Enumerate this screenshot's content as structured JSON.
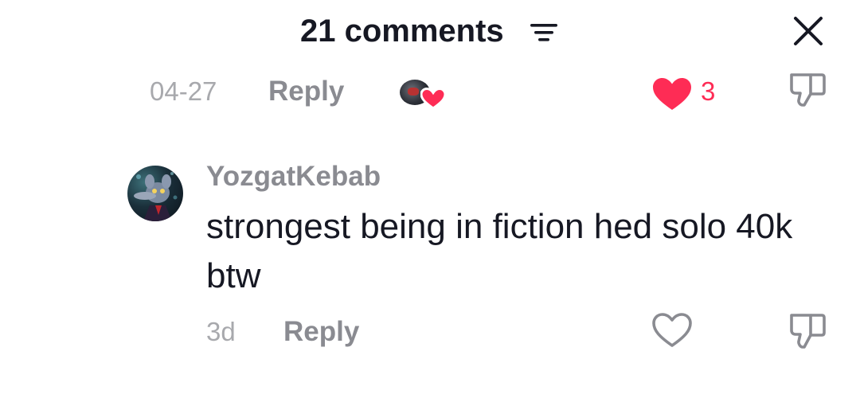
{
  "header": {
    "title": "21 comments",
    "sort_icon": "sort-lines-icon",
    "close_icon": "close-icon"
  },
  "previous_reply": {
    "date": "04-27",
    "reply_label": "Reply",
    "like_count": "3",
    "liked": true,
    "creator_liked": true
  },
  "comment": {
    "username": "YozgatKebab",
    "text": "strongest being in fiction hed solo 40k btw",
    "time": "3d",
    "reply_label": "Reply",
    "liked": false
  },
  "colors": {
    "like_red": "#fe2c55",
    "text_primary": "#161823",
    "text_secondary": "#8a8b91",
    "text_tertiary": "#a8a9ad"
  }
}
